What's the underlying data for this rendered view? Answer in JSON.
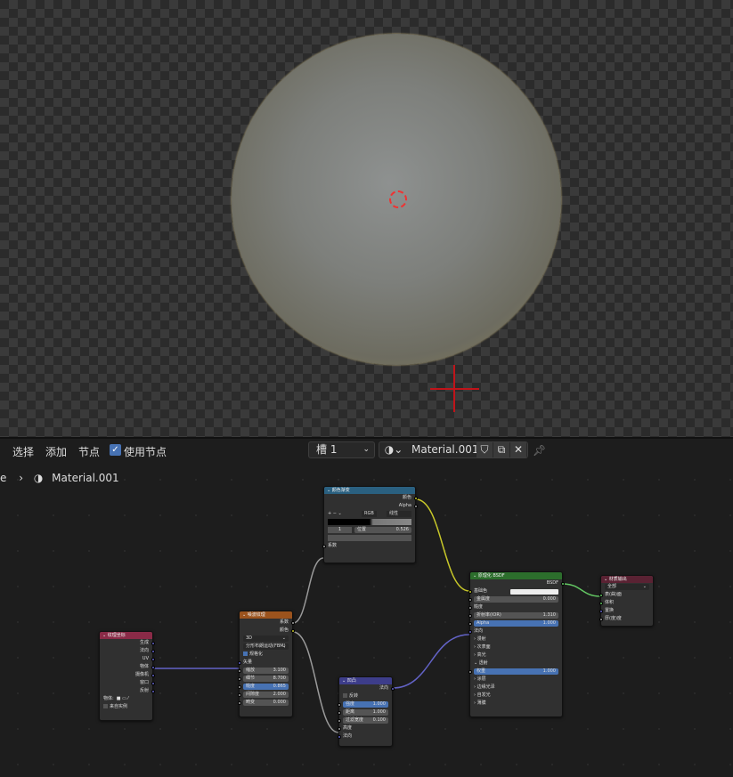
{
  "header": {
    "menu": [
      "选择",
      "添加",
      "节点"
    ],
    "use_nodes_label": "使用节点",
    "use_nodes": true,
    "slot": "槽 1",
    "material": "Material.001"
  },
  "breadcrumb": {
    "prefix": "e",
    "material": "Material.001"
  },
  "colors": {
    "wire_gray": "#9a9a9a",
    "wire_yellow": "#c7c729",
    "wire_blue": "#6363c7",
    "wire_green": "#63c763"
  },
  "nodes": {
    "texcoord": {
      "title": "纹理坐标",
      "color": "#8a2a47",
      "rows": [
        {
          "t": "out",
          "l": "生成",
          "s": "#6363c7"
        },
        {
          "t": "out",
          "l": "法向",
          "s": "#6363c7"
        },
        {
          "t": "out",
          "l": "UV",
          "s": "#6363c7"
        },
        {
          "t": "out",
          "l": "物体",
          "s": "#6363c7"
        },
        {
          "t": "out",
          "l": "摄像机",
          "s": "#6363c7"
        },
        {
          "t": "out",
          "l": "窗口",
          "s": "#6363c7"
        },
        {
          "t": "out",
          "l": "反射",
          "s": "#6363c7"
        },
        {
          "t": "obj",
          "l": "物体:"
        },
        {
          "t": "cb",
          "l": "来自实例",
          "on": false
        }
      ]
    },
    "noise": {
      "title": "噪波纹理",
      "color": "#9b531d",
      "rows": [
        {
          "t": "out",
          "l": "系数",
          "s": "#a1a1a1"
        },
        {
          "t": "out",
          "l": "颜色",
          "s": "#c7c729"
        },
        {
          "t": "dd",
          "l": "3D"
        },
        {
          "t": "dd",
          "l": "分形布朗运动(FBM)"
        },
        {
          "t": "cb",
          "l": "规格化",
          "on": true
        },
        {
          "t": "in",
          "l": "矢量",
          "s": "#6363c7"
        },
        {
          "t": "f",
          "l": "缩放",
          "v": "3.100",
          "s": "#a1a1a1"
        },
        {
          "t": "f",
          "l": "细节",
          "v": "8.700",
          "s": "#a1a1a1"
        },
        {
          "t": "f",
          "l": "糙度",
          "v": "0.865",
          "s": "#a1a1a1",
          "blue": true
        },
        {
          "t": "f",
          "l": "间隙度",
          "v": "2.000",
          "s": "#a1a1a1"
        },
        {
          "t": "f",
          "l": "畸变",
          "v": "0.000",
          "s": "#a1a1a1"
        }
      ]
    },
    "ramp": {
      "title": "颜色渐变",
      "color": "#2a6080",
      "rows": [
        {
          "t": "out",
          "l": "颜色",
          "s": "#c7c729"
        },
        {
          "t": "out",
          "l": "Alpha",
          "s": "#a1a1a1"
        },
        {
          "t": "ctl",
          "l": "+  −  ⌄",
          "m": "RGB",
          "i": "线性"
        },
        {
          "t": "grad"
        },
        {
          "t": "pos",
          "n": "1",
          "l": "位置",
          "v": "0.526"
        },
        {
          "t": "bar"
        },
        {
          "t": "in",
          "l": "系数",
          "s": "#a1a1a1"
        }
      ]
    },
    "bump": {
      "title": "凹凸",
      "color": "#3d3d8a",
      "rows": [
        {
          "t": "out",
          "l": "法向",
          "s": "#6363c7"
        },
        {
          "t": "cb",
          "l": "反转",
          "on": false
        },
        {
          "t": "f",
          "l": "强度",
          "v": "1.000",
          "s": "#a1a1a1",
          "blue": true
        },
        {
          "t": "f",
          "l": "距离",
          "v": "1.000",
          "s": "#a1a1a1"
        },
        {
          "t": "f",
          "l": "过滤宽度",
          "v": "0.100",
          "s": "#a1a1a1"
        },
        {
          "t": "in",
          "l": "高度",
          "s": "#a1a1a1"
        },
        {
          "t": "in",
          "l": "法向",
          "s": "#6363c7"
        }
      ]
    },
    "bsdf": {
      "title": "原理化 BSDF",
      "color": "#2c6e2c",
      "rows": [
        {
          "t": "out",
          "l": "BSDF",
          "s": "#63c763"
        },
        {
          "t": "color",
          "l": "基础色",
          "s": "#c7c729"
        },
        {
          "t": "f",
          "l": "金属度",
          "v": "0.000",
          "s": "#a1a1a1"
        },
        {
          "t": "in",
          "l": "糙度",
          "s": "#a1a1a1"
        },
        {
          "t": "f",
          "l": "折射率(IOR)",
          "v": "1.310",
          "s": "#a1a1a1"
        },
        {
          "t": "f",
          "l": "Alpha",
          "v": "1.000",
          "s": "#a1a1a1",
          "blue": true
        },
        {
          "t": "in",
          "l": "法向",
          "s": "#6363c7"
        },
        {
          "t": "p",
          "l": "›  漫射"
        },
        {
          "t": "p",
          "l": "›  次表面"
        },
        {
          "t": "p",
          "l": "›  高光"
        },
        {
          "t": "p",
          "l": "⌄  透射"
        },
        {
          "t": "f",
          "l": "权重",
          "v": "1.000",
          "s": "#a1a1a1",
          "blue": true
        },
        {
          "t": "p",
          "l": "›  涂层"
        },
        {
          "t": "p",
          "l": "›  边缘光泽"
        },
        {
          "t": "p",
          "l": "›  自发光"
        },
        {
          "t": "p",
          "l": "›  薄膜"
        }
      ]
    },
    "output": {
      "title": "材质输出",
      "color": "#5a2233",
      "rows": [
        {
          "t": "dd",
          "l": "全部"
        },
        {
          "t": "in",
          "l": "表(曲)面",
          "s": "#63c763"
        },
        {
          "t": "in",
          "l": "体积",
          "s": "#63c763"
        },
        {
          "t": "in",
          "l": "置换",
          "s": "#6363c7"
        },
        {
          "t": "in",
          "l": "厚(度)度",
          "s": "#a1a1a1"
        }
      ]
    }
  }
}
